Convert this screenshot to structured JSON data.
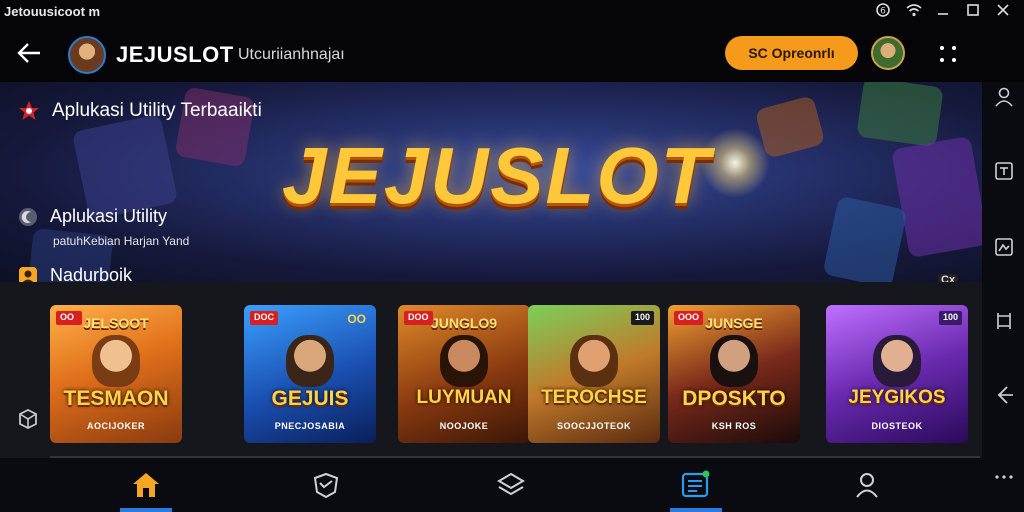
{
  "statusbar": {
    "title": "Jetouusicoot m"
  },
  "header": {
    "app_name": "JEJUSLOT",
    "app_subtitle": "Utcuriianhnajaı",
    "open_button": "SC Opreonrlı"
  },
  "banner": {
    "logo": "JEJUSLOT",
    "row1_label": "Aplukasi Utility Terbaaikti",
    "row2_label": "Aplukasi Utility",
    "row2_sub": "patuhKebian Harjan Yand",
    "row3_label": "Nadurboik",
    "corner_badge": "Cx"
  },
  "games": [
    {
      "badge": "OO",
      "badge2": "",
      "top": "JELSOOT",
      "title": "TESMAON",
      "sub": "AOCIJOKER"
    },
    {
      "badge": "DOC",
      "badge2": "OO",
      "top": "",
      "title": "GEJUIS",
      "sub": "PNECJOSABIA"
    },
    {
      "badge": "DOO",
      "badge2": "",
      "top": "JUNGLO9",
      "title": "LUYMUAN",
      "sub": "NOOJOKE"
    },
    {
      "badge": "",
      "badge2": "100",
      "top": "",
      "title": "TEROCHSE",
      "sub": "SOOCJJOTEOK"
    },
    {
      "badge": "OOO",
      "badge2": "",
      "top": "JUNSGE",
      "title": "DPOSKTO",
      "sub": "KSH ROS"
    },
    {
      "badge": "",
      "badge2": "100",
      "top": "",
      "title": "JEYGIKOS",
      "sub": "DIOSTEOK"
    }
  ],
  "colors": {
    "accent": "#f59a1b",
    "nav_active": "#2a7be0",
    "home_icon": "#f5a623"
  },
  "icons": {
    "statusbar": [
      "network-icon",
      "wifi-icon",
      "minimize-icon",
      "maximize-icon",
      "close-icon"
    ],
    "rightbar": [
      "user-icon",
      "bookmark-icon",
      "image-icon",
      "crop-icon",
      "back-icon",
      "more-icon"
    ],
    "bottomnav": [
      "home-icon",
      "shield-icon",
      "layers-icon",
      "news-icon",
      "profile-icon"
    ]
  }
}
